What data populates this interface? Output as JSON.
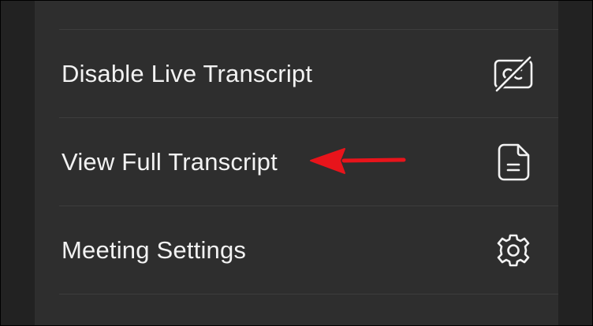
{
  "menu": {
    "items": [
      {
        "label": "Disable Live Transcript",
        "icon": "closed-captions-off-icon"
      },
      {
        "label": "View Full Transcript",
        "icon": "document-icon"
      },
      {
        "label": "Meeting Settings",
        "icon": "gear-icon"
      }
    ]
  },
  "annotation": {
    "arrow_color": "#e8141b",
    "points_to": "View Full Transcript"
  },
  "colors": {
    "background": "#222222",
    "sheet": "#2e2e2e",
    "divider": "#3d3d3d",
    "text": "#f2f2f2"
  }
}
